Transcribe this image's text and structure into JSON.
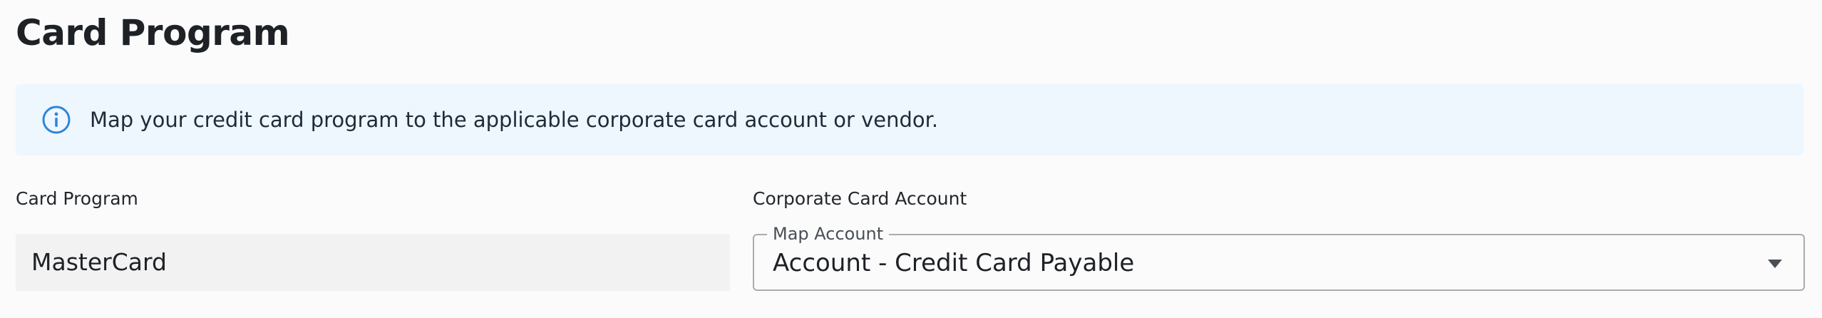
{
  "page": {
    "title": "Card Program"
  },
  "banner": {
    "icon": "info-circle-icon",
    "message": "Map your credit card program to the applicable corporate card account or vendor.",
    "accent_color": "#2e86d6",
    "background_color": "#eef6fe"
  },
  "form": {
    "card_program": {
      "label": "Card Program",
      "value": "MasterCard"
    },
    "corporate_card_account": {
      "label": "Corporate Card Account",
      "select_label": "Map Account",
      "selected_value": "Account - Credit Card Payable",
      "icon": "chevron-down-icon"
    }
  }
}
